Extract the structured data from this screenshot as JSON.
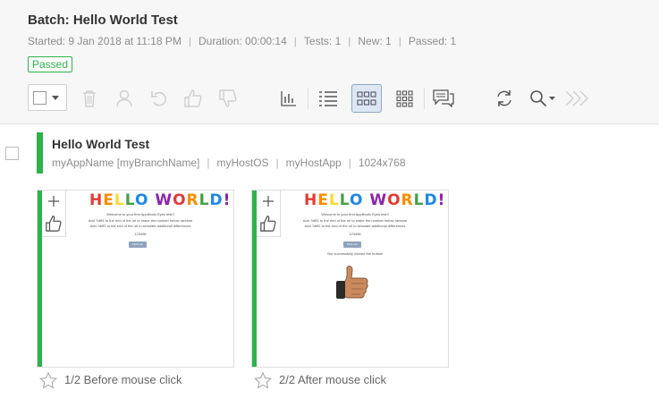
{
  "header": {
    "title": "Batch: Hello World Test",
    "meta": {
      "started": "Started: 9 Jan 2018 at 11:18 PM",
      "duration": "Duration: 00:00:14",
      "tests": "Tests: 1",
      "new": "New: 1",
      "passed": "Passed: 1"
    },
    "status_badge": "Passed",
    "status_color": "#2db34a"
  },
  "toolbar": {
    "icons": [
      "select-all-checkbox",
      "trash-icon",
      "user-icon",
      "undo-icon",
      "thumbs-up-icon",
      "thumbs-down-icon",
      "bar-chart-icon",
      "list-view-icon",
      "small-tiles-icon",
      "large-tiles-icon",
      "comments-icon",
      "refresh-icon",
      "search-icon",
      "collapse-icon"
    ],
    "active_view": "small-tiles-icon"
  },
  "test": {
    "name": "Hello World Test",
    "app": "myAppName [myBranchName]",
    "os": "myHostOS",
    "host_app": "myHostApp",
    "viewport": "1024x768"
  },
  "steps": [
    {
      "label": "1/2 Before mouse click",
      "screenshot": {
        "heading": "HELLO WORLD!",
        "line1": "Welcome to your first Applitools Eyes test!!",
        "line2": "Add ?diff1 to the end of the url to make the number below random",
        "line3": "Add ?diff2 to the end of the url to simulate additional differences",
        "number": "123456",
        "button": "Click me!"
      }
    },
    {
      "label": "2/2 After mouse click",
      "screenshot": {
        "heading": "HELLO WORLD!",
        "line1": "Welcome to your first Applitools Eyes test!!",
        "line2": "Add ?diff1 to the end of the url to make the number below random",
        "line3": "Add ?diff2 to the end of the url to simulate additional differences",
        "number": "123456",
        "button": "Click me!",
        "message": "You successfully clicked the button!"
      }
    }
  ]
}
